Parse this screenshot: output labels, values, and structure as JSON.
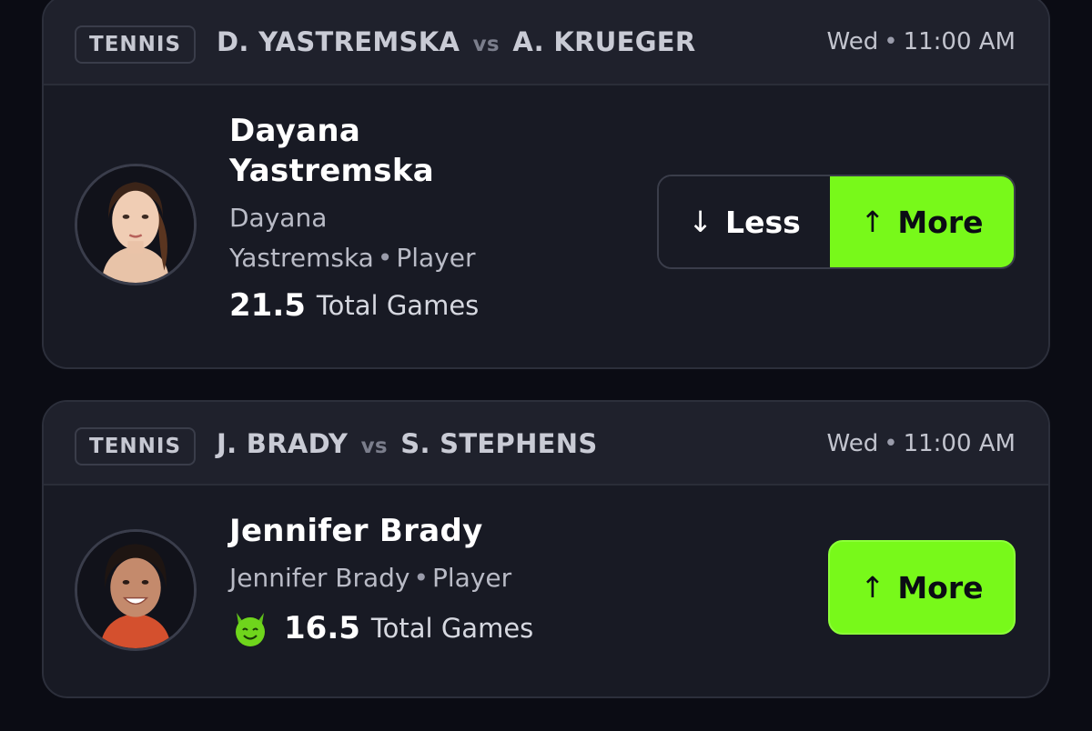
{
  "cards": [
    {
      "sport": "TENNIS",
      "player_a": "D. YASTREMSKA",
      "vs": "vs",
      "player_b": "A. KRUEGER",
      "day": "Wed",
      "time": "11:00 AM",
      "player_name": "Dayana Yastremska",
      "player_subtitle_name": "Dayana Yastremska",
      "player_role": "Player",
      "line_value": "21.5",
      "line_stat": "Total Games",
      "less_label": "Less",
      "more_label": "More",
      "less_arrow": "↓",
      "more_arrow": "↑",
      "more_selected": true
    },
    {
      "sport": "TENNIS",
      "player_a": "J. BRADY",
      "vs": "vs",
      "player_b": "S. STEPHENS",
      "day": "Wed",
      "time": "11:00 AM",
      "player_name": "Jennifer Brady",
      "player_subtitle_name": "Jennifer Brady",
      "player_role": "Player",
      "line_value": "16.5",
      "line_stat": "Total Games",
      "promo_icon": "green-devil-emoji-icon",
      "more_label": "More",
      "more_arrow": "↑",
      "more_selected": true
    }
  ],
  "colors": {
    "background": "#0b0c14",
    "card": "#181a24",
    "accent_green": "#78f91a"
  }
}
